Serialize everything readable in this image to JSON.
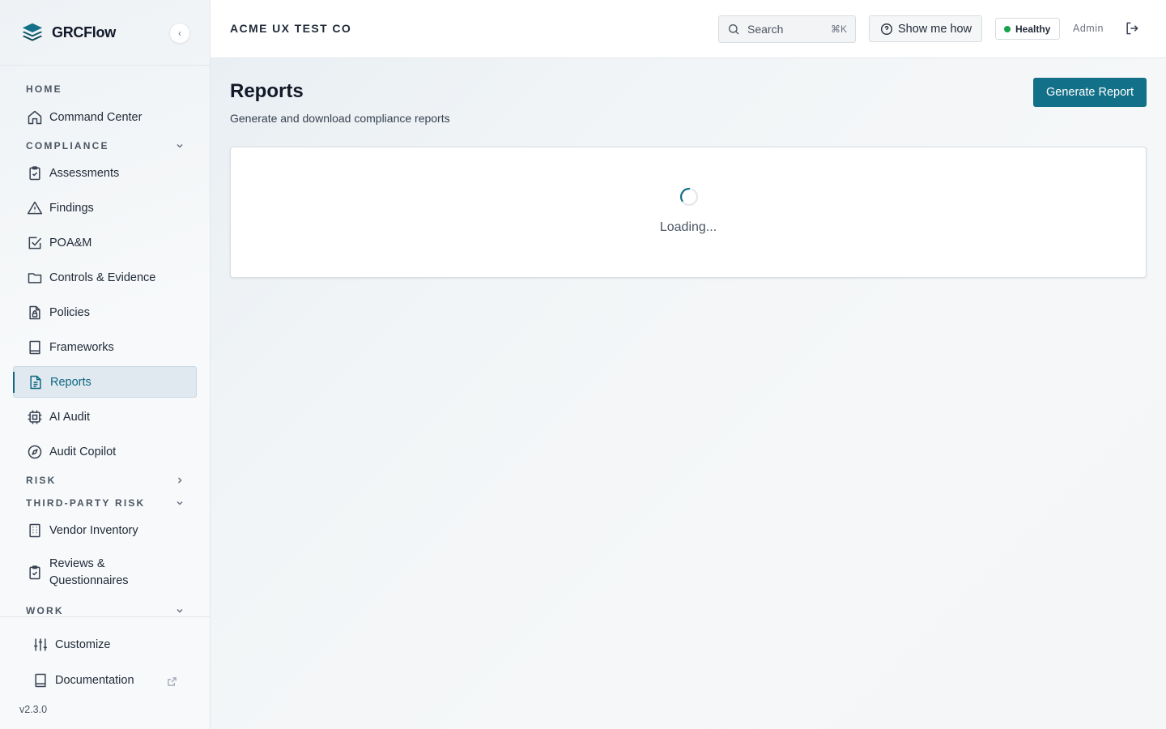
{
  "app": {
    "brand": "GRCFlow",
    "org_name": "ACME UX TEST CO",
    "version": "v2.3.0"
  },
  "topbar": {
    "search_placeholder": "Search",
    "search_shortcut": "⌘K",
    "show_me_how": "Show me how",
    "health_status": "Healthy",
    "user": "Admin"
  },
  "sidebar": {
    "sections": {
      "home": "HOME",
      "compliance": "COMPLIANCE",
      "risk": "RISK",
      "third_party_risk": "THIRD-PARTY RISK",
      "work": "WORK"
    },
    "items": {
      "command_center": "Command Center",
      "assessments": "Assessments",
      "findings": "Findings",
      "poam": "POA&M",
      "controls_evidence": "Controls & Evidence",
      "policies": "Policies",
      "frameworks": "Frameworks",
      "reports": "Reports",
      "ai_audit": "AI Audit",
      "audit_copilot": "Audit Copilot",
      "vendor_inventory": "Vendor Inventory",
      "reviews_line1": "Reviews &",
      "reviews_line2": "Questionnaires"
    },
    "bottom": {
      "customize": "Customize",
      "documentation": "Documentation"
    },
    "active_item": "Reports"
  },
  "main": {
    "title": "Reports",
    "subtitle": "Generate and download compliance reports",
    "generate_button": "Generate Report",
    "loading_text": "Loading..."
  },
  "colors": {
    "accent": "#137089",
    "active_text": "#0f6783",
    "healthy_dot": "#16a34a"
  }
}
